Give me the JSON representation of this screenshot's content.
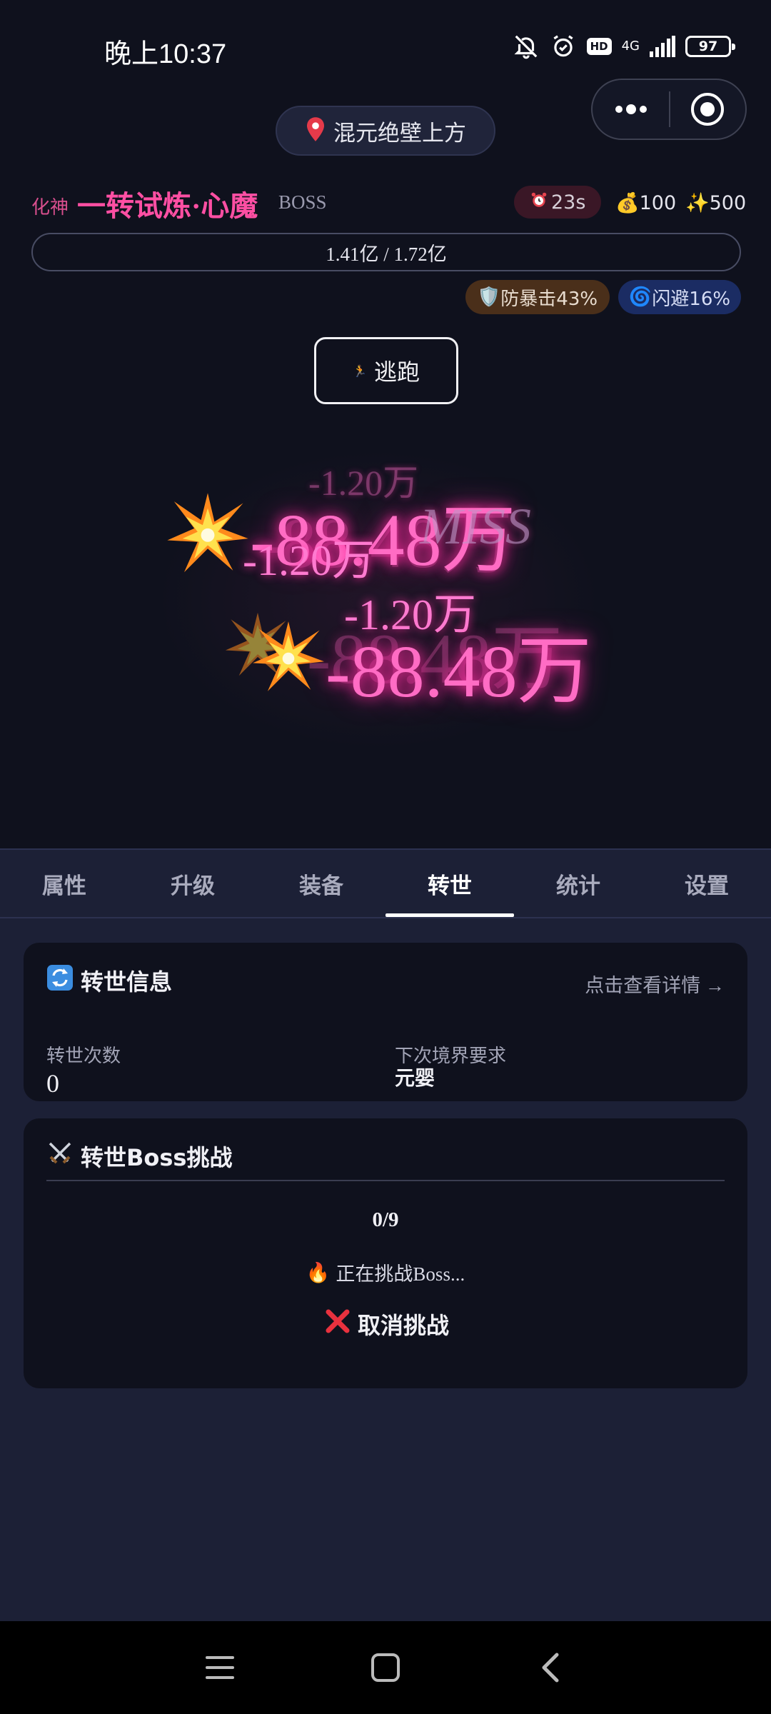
{
  "status_bar": {
    "time": "晚上10:37",
    "hd": "HD",
    "network": "4G",
    "battery": "97"
  },
  "location": {
    "icon": "pin-icon",
    "label": "混元绝壁上方"
  },
  "boss": {
    "realm": "化神",
    "name": "一转试炼·心魔",
    "tag": "BOSS",
    "timer": "23s",
    "gold": "100",
    "exp": "500",
    "hp_text": "1.41亿 / 1.72亿",
    "hp_fraction": 0.82,
    "crit_resist": "防暴击43%",
    "dodge": "闪避16%"
  },
  "flee_button": {
    "label": "逃跑"
  },
  "battle": {
    "damage_big": "-88.48万",
    "damage_small": "-1.20万",
    "miss": "MISS"
  },
  "tabs": [
    {
      "label": "属性",
      "active": false
    },
    {
      "label": "升级",
      "active": false
    },
    {
      "label": "装备",
      "active": false
    },
    {
      "label": "转世",
      "active": true
    },
    {
      "label": "统计",
      "active": false
    },
    {
      "label": "设置",
      "active": false
    }
  ],
  "rebirth_info": {
    "title": "转世信息",
    "detail_link": "点击查看详情 →",
    "count_label": "转世次数",
    "count_value": "0",
    "next_label": "下次境界要求",
    "next_value": "元婴"
  },
  "boss_challenge": {
    "title": "转世Boss挑战",
    "progress": "0/9",
    "status": "正在挑战Boss...",
    "cancel_label": "取消挑战"
  },
  "colors": {
    "background": "#0f111d",
    "accent_pink": "#ff4fa3",
    "panel": "#1c2036"
  }
}
